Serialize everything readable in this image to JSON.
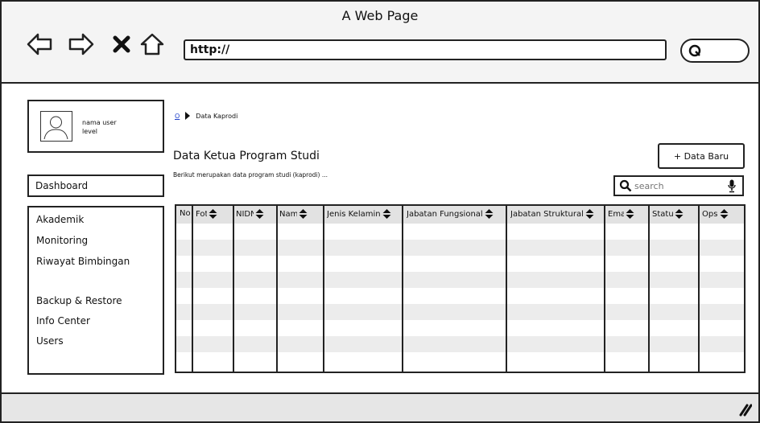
{
  "window": {
    "title": "A Web Page"
  },
  "toolbar": {
    "url": "http://",
    "back_icon": "arrow-left-icon",
    "forward_icon": "arrow-right-icon",
    "close_icon": "x-icon",
    "home_icon": "home-icon",
    "search_icon": "search-icon"
  },
  "user": {
    "name": "nama user",
    "level": "level"
  },
  "sidebar": {
    "dashboard": "Dashboard",
    "items": [
      "Akademik",
      "Monitoring",
      "Riwayat Bimbingan",
      "Backup & Restore",
      "Info Center",
      "Users"
    ]
  },
  "breadcrumb": {
    "home": "O",
    "current": "Data Kaprodi"
  },
  "page": {
    "title": "Data Ketua Program Studi",
    "description": "Berikut merupakan data program studi (kaprodi) ...",
    "add_button": "+ Data Baru"
  },
  "search": {
    "placeholder": "search"
  },
  "table": {
    "columns": [
      "No",
      "Foto",
      "NIDN",
      "Nama",
      "Jenis Kelamin",
      "Jabatan Fungsional",
      "Jabatan Struktural",
      "Email",
      "Status",
      "Opsi"
    ],
    "rows": 9
  },
  "colors": {
    "border": "#222222",
    "chrome": "#f4f4f4",
    "row_stripe": "#ececec",
    "header": "#e2e2e2",
    "link": "#1a3cc8"
  }
}
